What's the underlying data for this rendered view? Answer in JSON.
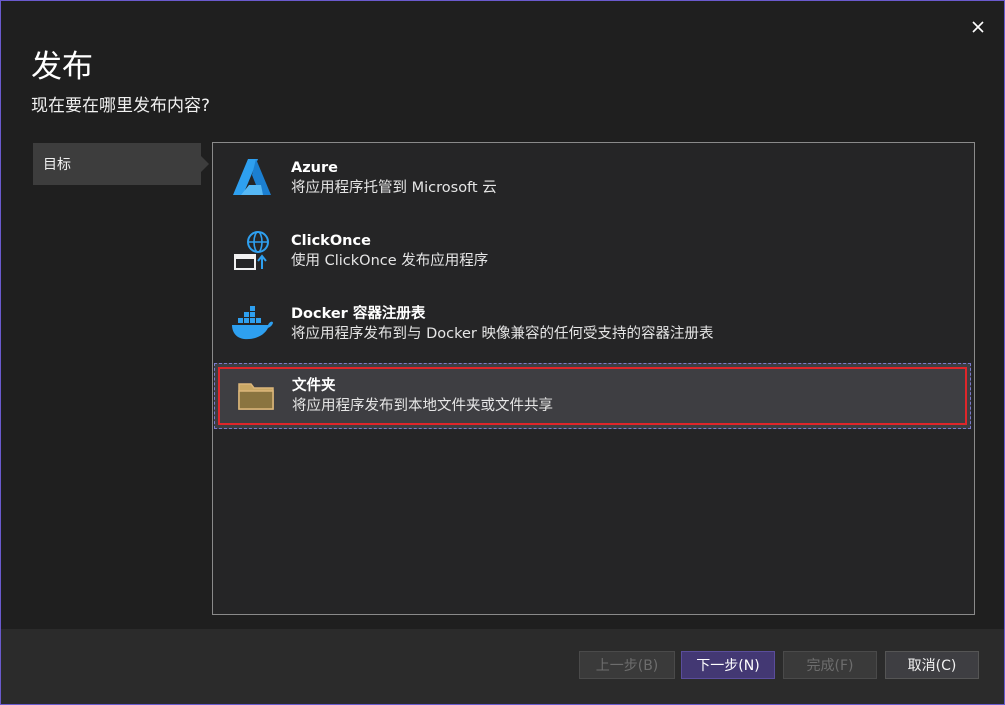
{
  "dialog": {
    "title": "发布",
    "subtitle": "现在要在哪里发布内容?"
  },
  "sidebar": {
    "items": [
      {
        "label": "目标"
      }
    ]
  },
  "targets": [
    {
      "name": "Azure",
      "desc": "将应用程序托管到 Microsoft 云",
      "icon": "azure-icon"
    },
    {
      "name": "ClickOnce",
      "desc": "使用 ClickOnce 发布应用程序",
      "icon": "clickonce-icon"
    },
    {
      "name": "Docker 容器注册表",
      "desc": "将应用程序发布到与 Docker 映像兼容的任何受支持的容器注册表",
      "icon": "docker-icon"
    },
    {
      "name": "文件夹",
      "desc": "将应用程序发布到本地文件夹或文件共享",
      "icon": "folder-icon",
      "selected": true
    }
  ],
  "footer": {
    "back_label": "上一步(B)",
    "next_label": "下一步(N)",
    "finish_label": "完成(F)",
    "cancel_label": "取消(C)"
  },
  "colors": {
    "accent": "#433873",
    "selection_border": "#e0262a",
    "azure_blue": "#2ea0f0",
    "docker_blue": "#2ea0f0",
    "folder_tan": "#dcb67a"
  }
}
